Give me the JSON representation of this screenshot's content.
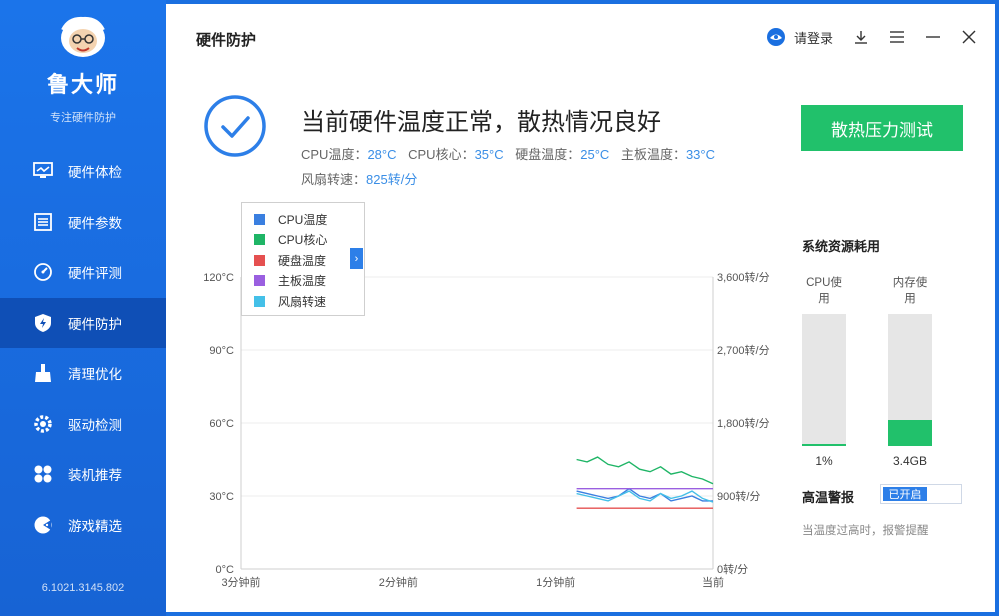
{
  "sidebar": {
    "brand": "鲁大师",
    "tagline": "专注硬件防护",
    "version": "6.1021.3145.802",
    "items": [
      {
        "label": "硬件体检",
        "icon": "monitor-icon"
      },
      {
        "label": "硬件参数",
        "icon": "list-icon"
      },
      {
        "label": "硬件评测",
        "icon": "gauge-icon"
      },
      {
        "label": "硬件防护",
        "icon": "shield-icon",
        "active": true
      },
      {
        "label": "清理优化",
        "icon": "broom-icon"
      },
      {
        "label": "驱动检测",
        "icon": "gear-icon"
      },
      {
        "label": "装机推荐",
        "icon": "grid-icon"
      },
      {
        "label": "游戏精选",
        "icon": "game-icon"
      }
    ]
  },
  "header": {
    "title": "硬件防护",
    "login": "请登录"
  },
  "status": {
    "title": "当前硬件温度正常，散热情况良好",
    "cpu_temp_label": "CPU温度：",
    "cpu_temp": "28°C",
    "cpu_core_label": "CPU核心：",
    "cpu_core": "35°C",
    "disk_temp_label": "硬盘温度：",
    "disk_temp": "25°C",
    "board_temp_label": "主板温度：",
    "board_temp": "33°C",
    "fan_label": "风扇转速：",
    "fan": "825转/分",
    "stress_button": "散热压力测试"
  },
  "legend": {
    "items": [
      {
        "label": "CPU温度",
        "color": "#3a7fe0"
      },
      {
        "label": "CPU核心",
        "color": "#1fb566"
      },
      {
        "label": "硬盘温度",
        "color": "#e55050"
      },
      {
        "label": "主板温度",
        "color": "#9a5fe0"
      },
      {
        "label": "风扇转速",
        "color": "#44c0e8"
      }
    ],
    "toggle": "›"
  },
  "chart_data": {
    "type": "line",
    "x_ticks": [
      "3分钟前",
      "2分钟前",
      "1分钟前",
      "当前"
    ],
    "y_left_ticks": [
      "120°C",
      "90°C",
      "60°C",
      "30°C",
      "0°C"
    ],
    "y_right_ticks": [
      "3,600转/分",
      "2,700转/分",
      "1,800转/分",
      "900转/分",
      "0转/分"
    ],
    "ylim_left": [
      0,
      120
    ],
    "ylim_right": [
      0,
      3600
    ],
    "x_range_seconds": [
      -180,
      0
    ],
    "grid": true,
    "series": [
      {
        "name": "CPU温度",
        "color": "#3a7fe0",
        "axis": "left",
        "x": [
          -52,
          -48,
          -44,
          -40,
          -36,
          -32,
          -28,
          -24,
          -20,
          -16,
          -12,
          -8,
          -4,
          0
        ],
        "y": [
          32,
          31,
          30,
          29,
          30,
          33,
          30,
          29,
          31,
          28,
          29,
          30,
          28,
          28
        ]
      },
      {
        "name": "CPU核心",
        "color": "#1fb566",
        "axis": "left",
        "x": [
          -52,
          -48,
          -44,
          -40,
          -36,
          -32,
          -28,
          -24,
          -20,
          -16,
          -12,
          -8,
          -4,
          0
        ],
        "y": [
          45,
          44,
          46,
          43,
          42,
          44,
          41,
          40,
          42,
          39,
          40,
          38,
          37,
          35
        ]
      },
      {
        "name": "硬盘温度",
        "color": "#e55050",
        "axis": "left",
        "x": [
          -52,
          0
        ],
        "y": [
          25,
          25
        ]
      },
      {
        "name": "主板温度",
        "color": "#9a5fe0",
        "axis": "left",
        "x": [
          -52,
          0
        ],
        "y": [
          33,
          33
        ]
      },
      {
        "name": "风扇转速",
        "color": "#44c0e8",
        "axis": "right",
        "x": [
          -52,
          -48,
          -44,
          -40,
          -36,
          -32,
          -28,
          -24,
          -20,
          -16,
          -12,
          -8,
          -4,
          0
        ],
        "y": [
          930,
          900,
          870,
          840,
          900,
          960,
          870,
          840,
          930,
          870,
          900,
          960,
          870,
          825
        ]
      }
    ]
  },
  "resources": {
    "title": "系统资源耗用",
    "cpu_label": "CPU使用",
    "cpu_value": "1%",
    "cpu_level": 0.01,
    "mem_label": "内存使用",
    "mem_value": "3.4GB",
    "mem_level": 0.2
  },
  "alarm": {
    "title": "高温警报",
    "state": "已开启",
    "desc": "当温度过高时，报警提醒"
  }
}
